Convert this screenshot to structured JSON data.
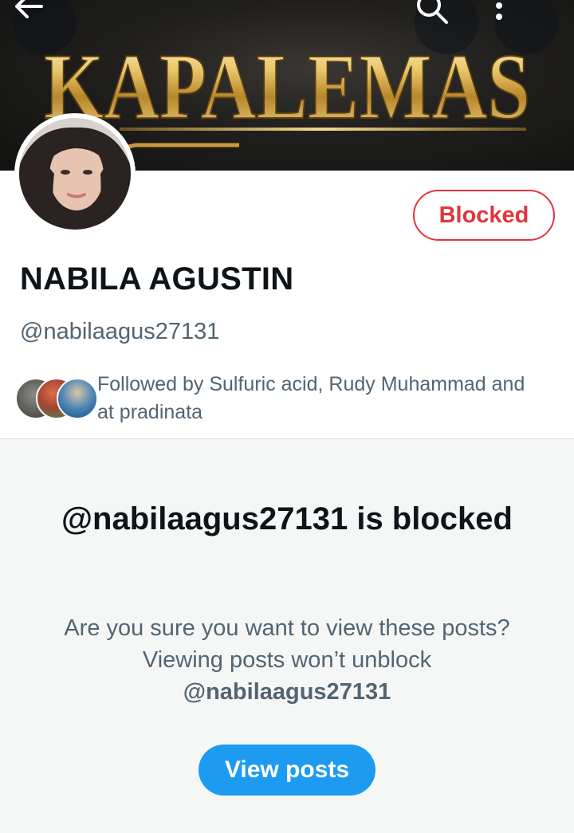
{
  "banner": {
    "text": "KAPALEMAS"
  },
  "top_bar": {
    "back_icon": "arrow-left-icon",
    "search_icon": "search-icon",
    "more_icon": "more-vertical-icon"
  },
  "profile": {
    "display_name": "NABILA AGUSTIN",
    "handle": "@nabilaagus27131",
    "relationship_button": "Blocked",
    "followed_by_text": "Followed by Sulfuric acid, Rudy Muhammad and at pradinata"
  },
  "blocked_notice": {
    "title": "@nabilaagus27131 is blocked",
    "description": "Are you sure you want to view these posts? Viewing posts won’t unblock",
    "description_handle": "@nabilaagus27131",
    "view_posts_button": "View posts"
  },
  "colors": {
    "accent_blue": "#1d9bf0",
    "blocked_red": "#e3343e",
    "secondary_text": "#536471",
    "primary_text": "#0f1419"
  }
}
